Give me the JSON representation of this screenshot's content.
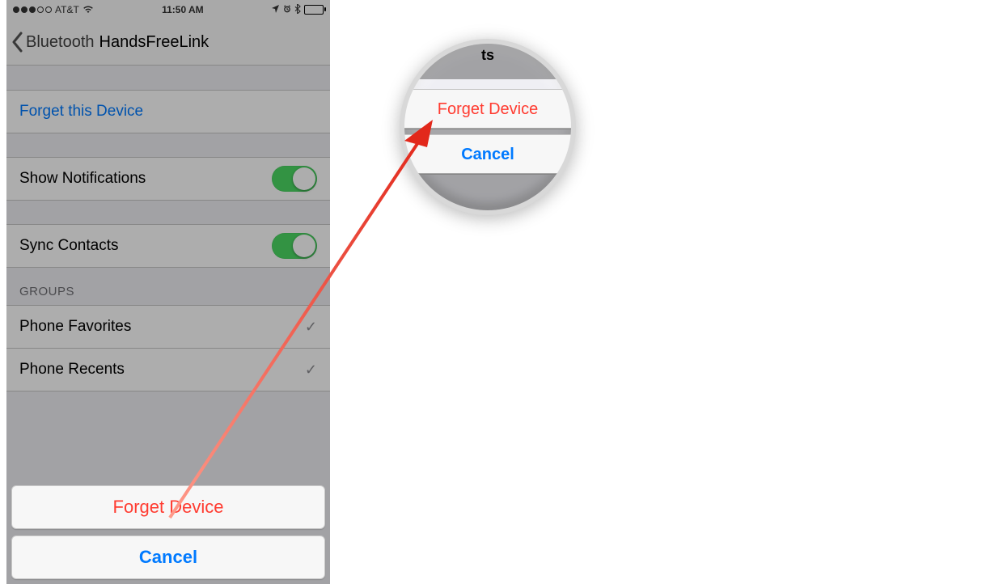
{
  "status_bar": {
    "carrier": "AT&T",
    "time": "11:50 AM"
  },
  "nav": {
    "back_label": "Bluetooth",
    "title": "HandsFreeLink"
  },
  "cells": {
    "forget_this_device": "Forget this Device",
    "show_notifications": "Show Notifications",
    "sync_contacts": "Sync Contacts"
  },
  "section_header": "GROUPS",
  "group_items": {
    "favorites": "Phone Favorites",
    "recents": "Phone Recents"
  },
  "action_sheet": {
    "forget": "Forget Device",
    "cancel": "Cancel"
  },
  "magnifier": {
    "top_fragment": "ts",
    "forget": "Forget Device",
    "cancel": "Cancel"
  }
}
